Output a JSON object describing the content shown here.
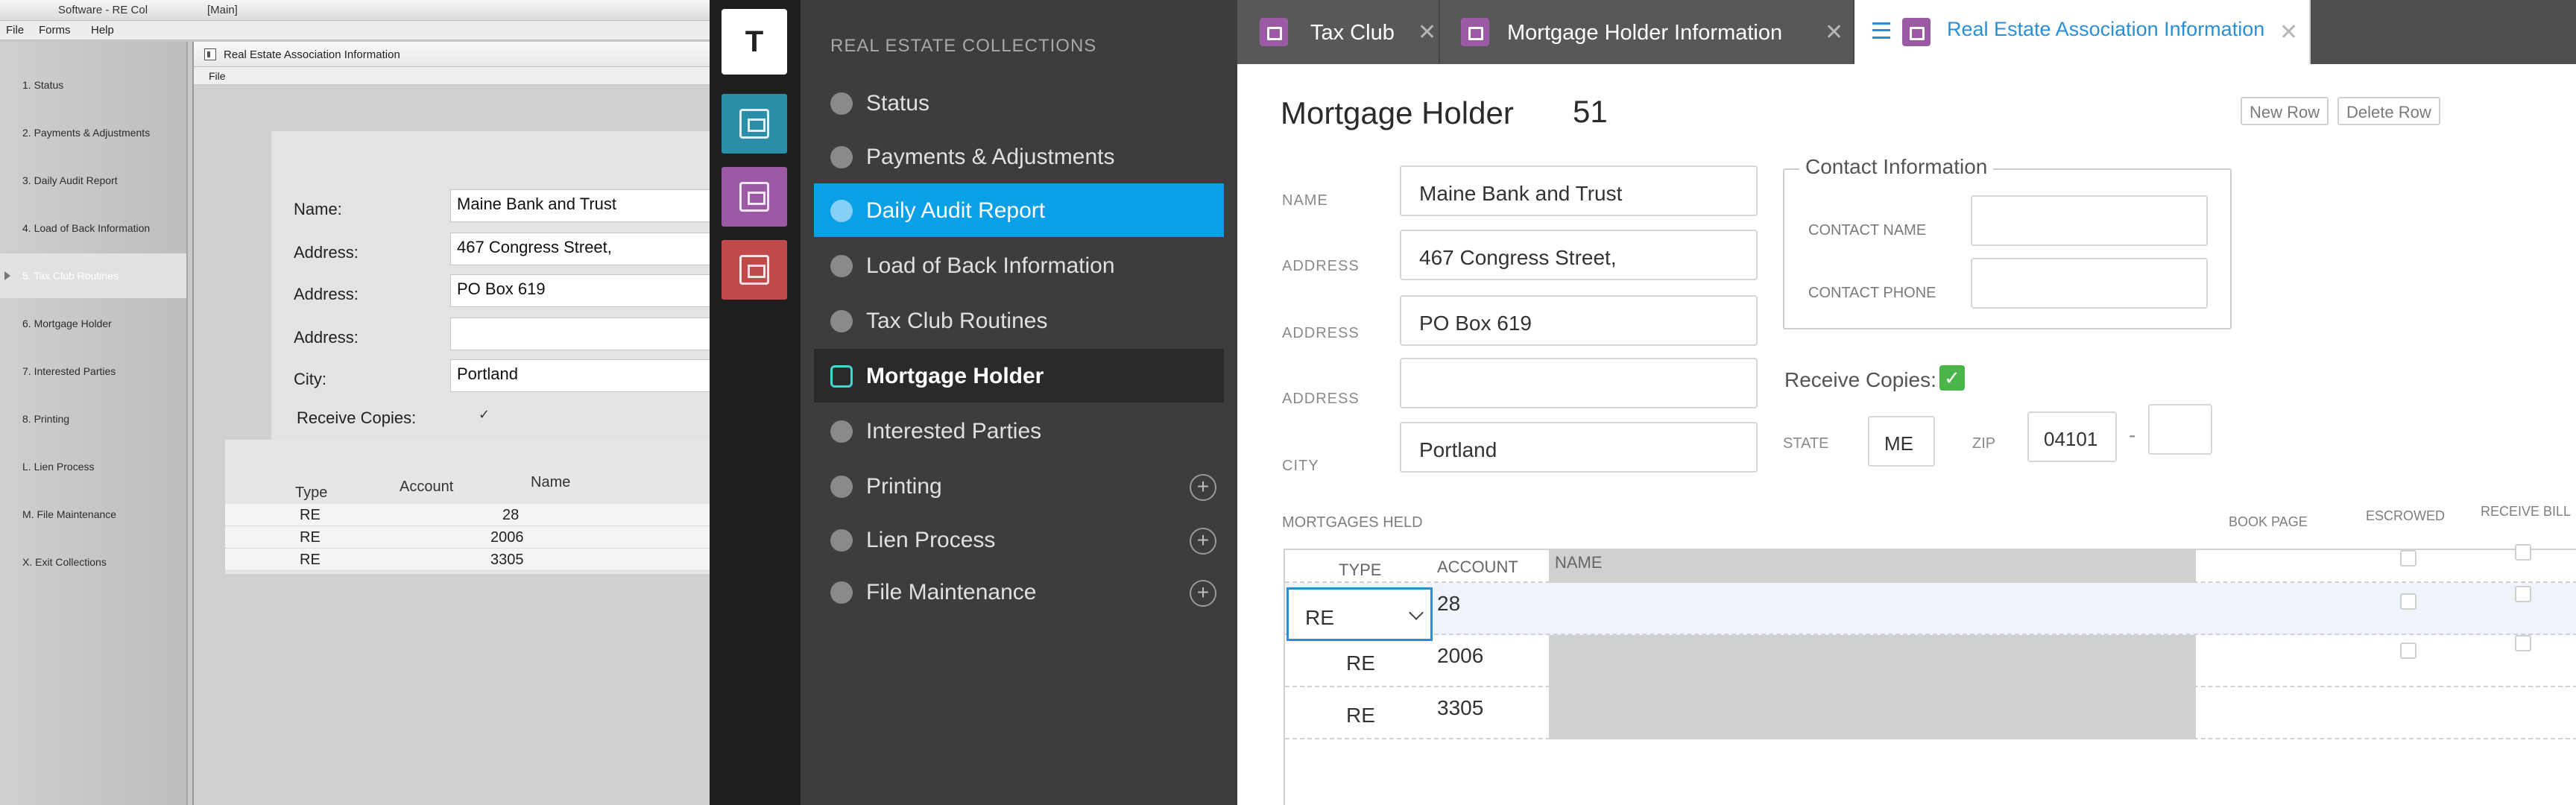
{
  "legacy": {
    "title_left": "Software - RE Col",
    "title_main": "[Main]",
    "menu": [
      "File",
      "Forms",
      "Help"
    ],
    "nav": [
      "1. Status",
      "2. Payments & Adjustments",
      "3. Daily Audit Report",
      "4. Load of Back Information",
      "5. Tax Club Routines",
      "6. Mortgage Holder",
      "7. Interested Parties",
      "8. Printing",
      "L. Lien Process",
      "M. File Maintenance",
      "X. Exit Collections"
    ],
    "child_title": "Real Estate Association Information",
    "child_menu": "File",
    "labels": {
      "name": "Name:",
      "address1": "Address:",
      "address2": "Address:",
      "address3": "Address:",
      "city": "City:",
      "receive": "Receive Copies:"
    },
    "values": {
      "name": "Maine Bank and Trust",
      "address1": "467 Congress Street,",
      "address2": "PO Box 619",
      "address3": "",
      "city": "Portland",
      "receive": "✓"
    },
    "grid_headers": {
      "type": "Type",
      "account": "Account",
      "name": "Name"
    },
    "grid_rows": [
      {
        "type": "RE",
        "account": "28"
      },
      {
        "type": "RE",
        "account": "2006"
      },
      {
        "type": "RE",
        "account": "3305"
      }
    ]
  },
  "rail": {
    "brand": "T",
    "colors": [
      "#2a8ea8",
      "#9b5aa3",
      "#c04a4a"
    ]
  },
  "sidebar": {
    "section": "REAL ESTATE COLLECTIONS",
    "items": [
      {
        "label": "Status",
        "icon": "info-icon"
      },
      {
        "label": "Payments & Adjustments",
        "icon": "dollar-icon"
      },
      {
        "label": "Daily Audit Report",
        "icon": "flag-icon"
      },
      {
        "label": "Load of Back Information",
        "icon": "back-arrow-icon"
      },
      {
        "label": "Tax Club Routines",
        "icon": "dollar-icon"
      },
      {
        "label": "Mortgage Holder",
        "icon": "house-icon"
      },
      {
        "label": "Interested Parties",
        "icon": "thumbs-up-icon"
      },
      {
        "label": "Printing",
        "icon": "printer-icon"
      },
      {
        "label": "Lien Process",
        "icon": "folder-icon"
      },
      {
        "label": "File Maintenance",
        "icon": "layers-icon"
      }
    ],
    "accent": "#0aa0e8"
  },
  "tabs": [
    {
      "label": "Tax Club",
      "close": "✕"
    },
    {
      "label": "Mortgage Holder Information",
      "close": "✕"
    },
    {
      "label": "Real Estate Association Information",
      "close": "✕"
    }
  ],
  "main": {
    "title": "Mortgage Holder",
    "number": "51",
    "new_row": "New Row",
    "delete_row": "Delete Row",
    "labels": {
      "name": "NAME",
      "address1": "ADDRESS",
      "address2": "ADDRESS",
      "address3": "ADDRESS",
      "city": "CITY",
      "state": "STATE",
      "zip": "ZIP",
      "receive": "Receive Copies:",
      "mortgages": "MORTGAGES HELD",
      "book_page": "BOOK PAGE",
      "escrowed": "ESCROWED",
      "receive_bill": "RECEIVE BILL"
    },
    "values": {
      "name": "Maine Bank and Trust",
      "address1": "467 Congress Street,",
      "address2": "PO Box 619",
      "address3": "",
      "city": "Portland",
      "state": "ME",
      "zip": "04101",
      "zip_dash": "-",
      "zip4": "",
      "receive_check": "✓"
    },
    "contact": {
      "legend": "Contact Information",
      "name_label": "CONTACT NAME",
      "phone_label": "CONTACT PHONE",
      "name_value": "",
      "phone_value": ""
    },
    "grid": {
      "headers": {
        "type": "TYPE",
        "account": "ACCOUNT",
        "name": "NAME"
      },
      "rows": [
        {
          "type": "RE",
          "account": "28"
        },
        {
          "type": "RE",
          "account": "2006"
        },
        {
          "type": "RE",
          "account": "3305"
        }
      ]
    },
    "accent": "#2a8fd6",
    "check_color": "#4ab54a"
  }
}
